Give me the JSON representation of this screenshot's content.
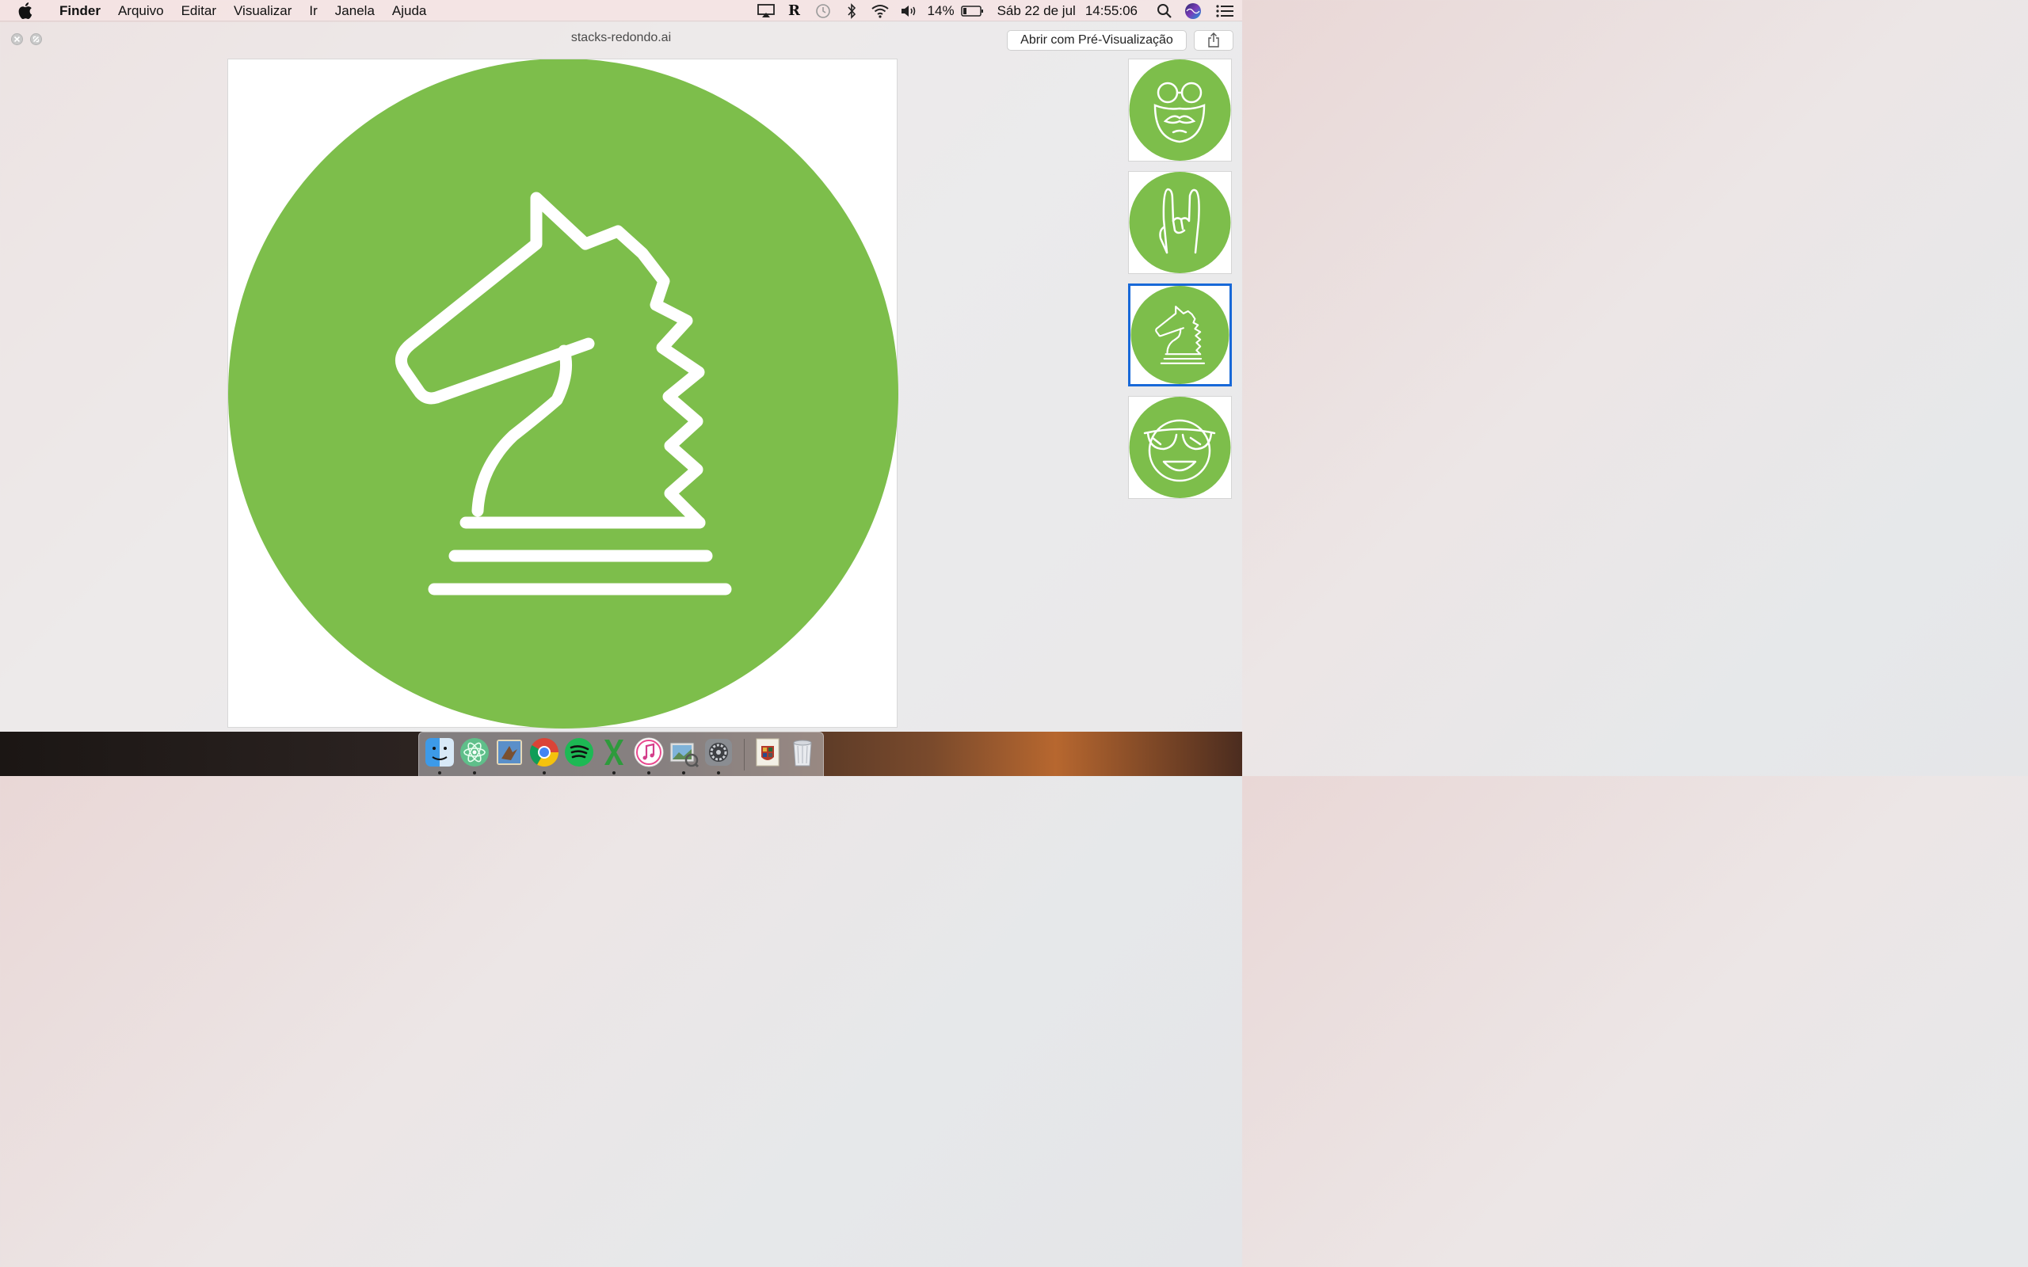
{
  "menubar": {
    "app_name": "Finder",
    "items": [
      "Arquivo",
      "Editar",
      "Visualizar",
      "Ir",
      "Janela",
      "Ajuda"
    ],
    "battery": "14%",
    "date": "Sáb 22 de jul",
    "time": "14:55:06",
    "status_icons": [
      "airplay-icon",
      "r-app-icon",
      "time-machine-icon",
      "bluetooth-icon",
      "wifi-icon",
      "volume-icon",
      "battery-icon",
      "spotlight-icon",
      "siri-icon",
      "notification-center-icon"
    ]
  },
  "quicklook": {
    "title": "stacks-redondo.ai",
    "open_button": "Abrir com Pré-Visualização",
    "selected_page": 3,
    "thumbnails": [
      "glasses-mustache-face",
      "rock-hand",
      "chess-knight",
      "sunglasses-smile"
    ],
    "colors": {
      "artwork_green": "#7dbe4b",
      "selection_blue": "#1869d8"
    }
  },
  "dock": {
    "apps": [
      "Finder",
      "Atom",
      "Mail",
      "Google Chrome",
      "Spotify",
      "Excel",
      "iTunes",
      "Image Capture",
      "Preferências do Sistema",
      "Hogwarts",
      "Lixo"
    ]
  }
}
